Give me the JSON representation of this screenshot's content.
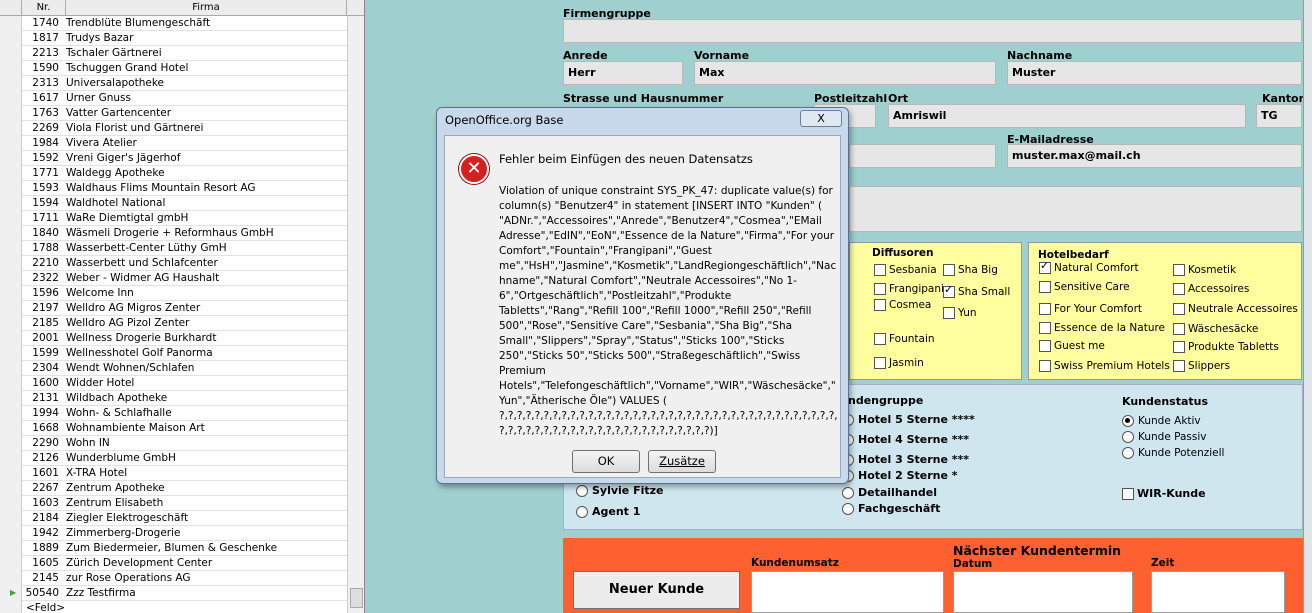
{
  "grid": {
    "col_nr": "Nr.",
    "col_firma": "Firma",
    "rows": [
      {
        "nr": "1740",
        "firma": "Trendblüte Blumengeschäft"
      },
      {
        "nr": "1817",
        "firma": "Trudys Bazar"
      },
      {
        "nr": "2213",
        "firma": "Tschaler Gärtnerei"
      },
      {
        "nr": "1590",
        "firma": "Tschuggen Grand Hotel"
      },
      {
        "nr": "2313",
        "firma": "Universalapotheke"
      },
      {
        "nr": "1617",
        "firma": "Urner Gnuss"
      },
      {
        "nr": "1763",
        "firma": "Vatter Gartencenter"
      },
      {
        "nr": "2269",
        "firma": "Viola Florist und Gärtnerei"
      },
      {
        "nr": "1984",
        "firma": "Vivera Atelier"
      },
      {
        "nr": "1592",
        "firma": "Vreni Giger's Jägerhof"
      },
      {
        "nr": "1771",
        "firma": "Waldegg Apotheke"
      },
      {
        "nr": "1593",
        "firma": "Waldhaus Flims Mountain Resort AG"
      },
      {
        "nr": "1594",
        "firma": "Waldhotel National"
      },
      {
        "nr": "1711",
        "firma": "WaRe Diemtigtal gmbH"
      },
      {
        "nr": "1840",
        "firma": "Wäsmeli Drogerie + Reformhaus GmbH"
      },
      {
        "nr": "1788",
        "firma": "Wasserbett-Center Lüthy GmH"
      },
      {
        "nr": "2210",
        "firma": "Wasserbett  und Schlafcenter"
      },
      {
        "nr": "2322",
        "firma": "Weber - Widmer AG Haushalt"
      },
      {
        "nr": "1596",
        "firma": "Welcome Inn"
      },
      {
        "nr": "2197",
        "firma": "Welldro AG Migros Zenter"
      },
      {
        "nr": "2185",
        "firma": "Welldro AG  Pizol Zenter"
      },
      {
        "nr": "2001",
        "firma": "Wellness Drogerie Burkhardt"
      },
      {
        "nr": "1599",
        "firma": "Wellnesshotel Golf Panorma"
      },
      {
        "nr": "2304",
        "firma": "Wendt Wohnen/Schlafen"
      },
      {
        "nr": "1600",
        "firma": "Widder Hotel"
      },
      {
        "nr": "2131",
        "firma": "Wildbach Apotheke"
      },
      {
        "nr": "1994",
        "firma": "Wohn- & Schlafhalle"
      },
      {
        "nr": "1668",
        "firma": "Wohnambiente Maison Art"
      },
      {
        "nr": "2290",
        "firma": "Wohn IN"
      },
      {
        "nr": "2126",
        "firma": "Wunderblume GmbH"
      },
      {
        "nr": "1601",
        "firma": "X-TRA Hotel"
      },
      {
        "nr": "2267",
        "firma": "Zentrum Apotheke"
      },
      {
        "nr": "1603",
        "firma": "Zentrum Elisabeth"
      },
      {
        "nr": "2184",
        "firma": "Ziegler Elektrogeschäft"
      },
      {
        "nr": "1942",
        "firma": "Zimmerberg-Drogerie"
      },
      {
        "nr": "1889",
        "firma": "Zum Biedermeier, Blumen & Geschenke"
      },
      {
        "nr": "1605",
        "firma": "Zürich Development Center"
      },
      {
        "nr": "2145",
        "firma": "zur Rose Operations  AG"
      },
      {
        "nr": "50540",
        "firma": "Zzz Testfirma"
      }
    ],
    "new_row": "<Feld>"
  },
  "form": {
    "firmengruppe_label": "Firmengruppe",
    "firmengruppe_value": "",
    "anrede_label": "Anrede",
    "anrede_value": "Herr",
    "vorname_label": "Vorname",
    "vorname_value": "Max",
    "nachname_label": "Nachname",
    "nachname_value": "Muster",
    "strasse_label": "Strasse und Hausnummer",
    "plz_label": "Postleitzahl",
    "ort_label": "Ort",
    "ort_value": "Amriswil",
    "kanton_label": "Kanton",
    "kanton_value": "TG",
    "email_label": "E-Mailadresse",
    "email_value": "muster.max@mail.ch"
  },
  "diffusoren": {
    "title": "Diffusoren",
    "items": [
      {
        "label": "Sesbania",
        "checked": false
      },
      {
        "label": "Sha Big",
        "checked": false
      },
      {
        "label": "Frangipani",
        "checked": false
      },
      {
        "label": "Sha Small",
        "checked": true
      },
      {
        "label": "Cosmea",
        "checked": false
      },
      {
        "label": "Yun",
        "checked": false
      },
      {
        "label": "Fountain",
        "checked": false
      },
      {
        "label": "Jasmin",
        "checked": false
      }
    ]
  },
  "hotelbedarf": {
    "title": "Hotelbedarf",
    "items": [
      {
        "label": "Natural Comfort",
        "checked": true
      },
      {
        "label": "Kosmetik",
        "checked": false
      },
      {
        "label": "Sensitive Care",
        "checked": false
      },
      {
        "label": "Accessoires",
        "checked": false
      },
      {
        "label": "For Your Comfort",
        "checked": false
      },
      {
        "label": "Neutrale Accessoires",
        "checked": false
      },
      {
        "label": "Essence de la Nature",
        "checked": false
      },
      {
        "label": "Wäschesäcke",
        "checked": false
      },
      {
        "label": "Guest me",
        "checked": false
      },
      {
        "label": "Produkte Tabletts",
        "checked": false
      },
      {
        "label": "Swiss Premium Hotels",
        "checked": false
      },
      {
        "label": "Slippers",
        "checked": false
      }
    ]
  },
  "kundengruppe": {
    "title": "ndengruppe",
    "options": [
      "Hotel 5 Sterne ****",
      "Hotel 4 Sterne ***",
      "Hotel 3 Sterne ***",
      "Hotel 2 Sterne *",
      "Detailhandel",
      "Fachgeschäft"
    ],
    "left_options": [
      "Sylvie Fitze",
      "Agent 1"
    ]
  },
  "kundenstatus": {
    "title": "Kundenstatus",
    "options": [
      {
        "label": "Kunde Aktiv",
        "checked": true
      },
      {
        "label": "Kunde Passiv",
        "checked": false
      },
      {
        "label": "Kunde Potenziell",
        "checked": false
      }
    ],
    "wir_label": "WIR-Kunde"
  },
  "termin": {
    "title": "Nächster Kundentermin",
    "neuer_kunde": "Neuer Kunde",
    "umsatz_label": "Kundenumsatz",
    "datum_label": "Datum",
    "zeit_label": "Zeit"
  },
  "dialog": {
    "title": "OpenOffice.org Base",
    "close": "X",
    "heading": "Fehler beim Einfügen des neuen Datensatzs",
    "message": "Violation of unique constraint SYS_PK_47: duplicate value(s) for column(s) \"Benutzer4\" in statement [INSERT INTO \"Kunden\" ( \"ADNr.\",\"Accessoires\",\"Anrede\",\"Benutzer4\",\"Cosmea\",\"EMail Adresse\",\"EdIN\",\"EoN\",\"Essence de la Nature\",\"Firma\",\"For your Comfort\",\"Fountain\",\"Frangipani\",\"Guest me\",\"HsH\",\"Jasmine\",\"Kosmetik\",\"LandRegiongeschäftlich\",\"Nachname\",\"Natural Comfort\",\"Neutrale Accessoires\",\"No 1-6\",\"Ortgeschäftlich\",\"Postleitzahl\",\"Produkte Tabletts\",\"Rang\",\"Refill 100\",\"Refill 1000\",\"Refill 250\",\"Refill 500\",\"Rose\",\"Sensitive Care\",\"Sesbania\",\"Sha Big\",\"Sha Small\",\"Slippers\",\"Spray\",\"Status\",\"Sticks 100\",\"Sticks 250\",\"Sticks 50\",\"Sticks 500\",\"Straßegeschäftlich\",\"Swiss Premium Hotels\",\"Telefongeschäftlich\",\"Vorname\",\"WIR\",\"Wäschesäcke\",\"Yun\",\"Ätherische Öle\") VALUES ( ?,?,?,?,?,?,?,?,?,?,?,?,?,?,?,?,?,?,?,?,?,?,?,?,?,?,?,?,?,?,?,?,?,?,?,?,?,?,?,?,?,?,?,?,?,?,?,?,?,?,?,?,?,?,?,?,?,?,?,?,?,?)]",
    "ok": "OK",
    "zusaetze": "Zusätze"
  }
}
